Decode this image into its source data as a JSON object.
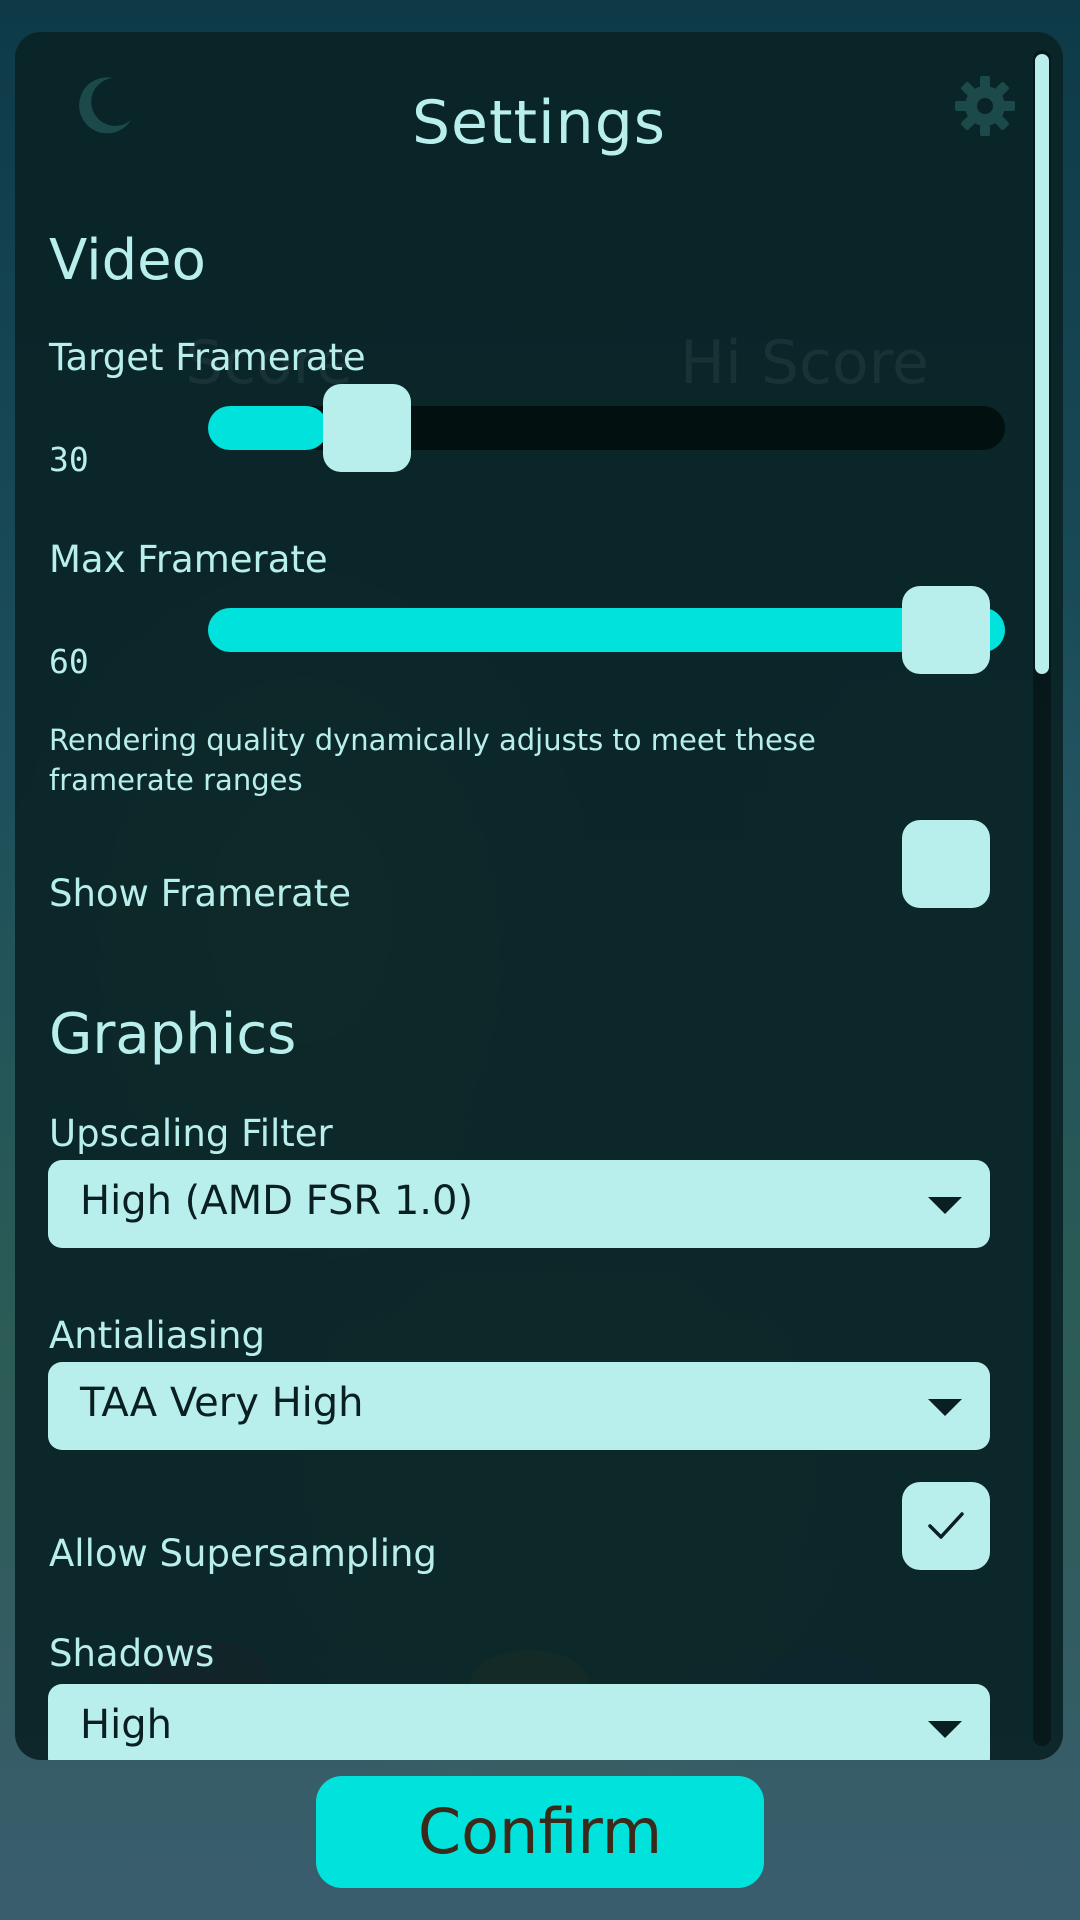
{
  "header": {
    "title": "Settings"
  },
  "background_text": {
    "score": "Score",
    "hi_score": "Hi Score"
  },
  "video": {
    "heading": "Video",
    "target_framerate": {
      "label": "Target Framerate",
      "value": "30",
      "fill_fraction": 0.18
    },
    "max_framerate": {
      "label": "Max Framerate",
      "value": "60",
      "fill_fraction": 1.0
    },
    "help_text": "Rendering quality dynamically adjusts to meet these framerate ranges",
    "show_framerate": {
      "label": "Show Framerate",
      "checked": false
    }
  },
  "graphics": {
    "heading": "Graphics",
    "upscaling_filter": {
      "label": "Upscaling Filter",
      "value": "High (AMD FSR 1.0)"
    },
    "antialiasing": {
      "label": "Antialiasing",
      "value": "TAA Very High"
    },
    "allow_supersampling": {
      "label": "Allow Supersampling",
      "checked": true
    },
    "shadows": {
      "label": "Shadows",
      "value": "High"
    }
  },
  "footer": {
    "confirm_label": "Confirm"
  },
  "colors": {
    "accent": "#00e2dc",
    "control": "#b8efec",
    "panel": "#0a2326"
  }
}
